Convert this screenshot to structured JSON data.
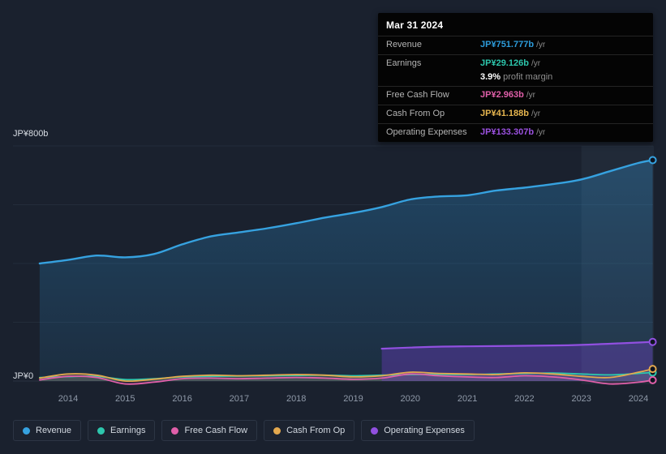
{
  "tooltip": {
    "date": "Mar 31 2024",
    "rows": [
      {
        "label": "Revenue",
        "value": "JP¥751.777b",
        "suffix": "/yr",
        "color": "#2d9cdb"
      },
      {
        "label": "Earnings",
        "value": "JP¥29.126b",
        "suffix": "/yr",
        "color": "#2dc7ad"
      },
      {
        "label": "Free Cash Flow",
        "value": "JP¥2.963b",
        "suffix": "/yr",
        "color": "#e05fa9"
      },
      {
        "label": "Cash From Op",
        "value": "JP¥41.188b",
        "suffix": "/yr",
        "color": "#e7b64f"
      },
      {
        "label": "Operating Expenses",
        "value": "JP¥133.307b",
        "suffix": "/yr",
        "color": "#9b51e0"
      }
    ],
    "margin": {
      "pct": "3.9%",
      "text": "profit margin"
    }
  },
  "axes": {
    "y_top": "JP¥800b",
    "y_zero": "JP¥0"
  },
  "legend": {
    "items": [
      {
        "label": "Revenue",
        "color": "#36a2e0"
      },
      {
        "label": "Earnings",
        "color": "#2dc7ad"
      },
      {
        "label": "Free Cash Flow",
        "color": "#e05fa9"
      },
      {
        "label": "Cash From Op",
        "color": "#e3a84e"
      },
      {
        "label": "Operating Expenses",
        "color": "#9150e0"
      }
    ]
  },
  "chart_data": {
    "type": "line",
    "title": "Revenue and expenses history",
    "currency_unit": "JP¥ billions",
    "ylim": [
      0,
      800
    ],
    "gridlines_b": [
      0,
      200,
      400,
      600,
      800
    ],
    "y_tick_labels_shown": [
      "JP¥800b",
      "JP¥0"
    ],
    "x_ticks": [
      "2014",
      "2015",
      "2016",
      "2017",
      "2018",
      "2019",
      "2020",
      "2021",
      "2022",
      "2023",
      "2024"
    ],
    "highlight_from_x": 2023.0,
    "x": [
      2013.5,
      2014,
      2014.5,
      2015,
      2015.5,
      2016,
      2016.5,
      2017,
      2017.5,
      2018,
      2018.5,
      2019,
      2019.5,
      2020,
      2020.5,
      2021,
      2021.5,
      2022,
      2022.5,
      2023,
      2023.5,
      2024,
      2024.25
    ],
    "series": [
      {
        "name": "Revenue",
        "color": "#36a2e0",
        "fill": "gradient",
        "width": 2.4,
        "values": [
          400,
          412,
          427,
          421,
          432,
          465,
          492,
          506,
          520,
          537,
          556,
          572,
          592,
          618,
          628,
          632,
          648,
          658,
          670,
          686,
          714,
          742,
          751.8
        ]
      },
      {
        "name": "Earnings",
        "color": "#2dc7ad",
        "fill": "rgba(45,199,173,0.16)",
        "width": 1.8,
        "values": [
          12,
          15,
          16,
          5,
          8,
          14,
          16,
          17,
          18,
          19,
          20,
          18,
          20,
          22,
          23,
          22,
          24,
          26,
          27,
          24,
          21,
          26,
          29.1
        ]
      },
      {
        "name": "Free Cash Flow",
        "color": "#e05fa9",
        "fill": "rgba(224,95,169,0.10)",
        "width": 1.8,
        "values": [
          4,
          16,
          12,
          -10,
          -4,
          8,
          10,
          8,
          10,
          12,
          10,
          6,
          10,
          24,
          18,
          14,
          12,
          18,
          14,
          4,
          -10,
          -4,
          3.0
        ]
      },
      {
        "name": "Cash From Op",
        "color": "#e3a84e",
        "fill": "rgba(227,168,78,0.12)",
        "width": 1.8,
        "values": [
          10,
          24,
          20,
          0,
          6,
          16,
          20,
          18,
          20,
          22,
          20,
          14,
          18,
          30,
          26,
          24,
          22,
          28,
          24,
          16,
          12,
          30,
          41.2
        ]
      },
      {
        "name": "Operating Expenses",
        "color": "#9150e0",
        "fill": "rgba(128,62,224,0.32)",
        "width": 2.2,
        "values": [
          null,
          null,
          null,
          null,
          null,
          null,
          null,
          null,
          null,
          null,
          null,
          null,
          110,
          114,
          117,
          118,
          119,
          120,
          121,
          123,
          127,
          131,
          133.3
        ]
      }
    ]
  }
}
